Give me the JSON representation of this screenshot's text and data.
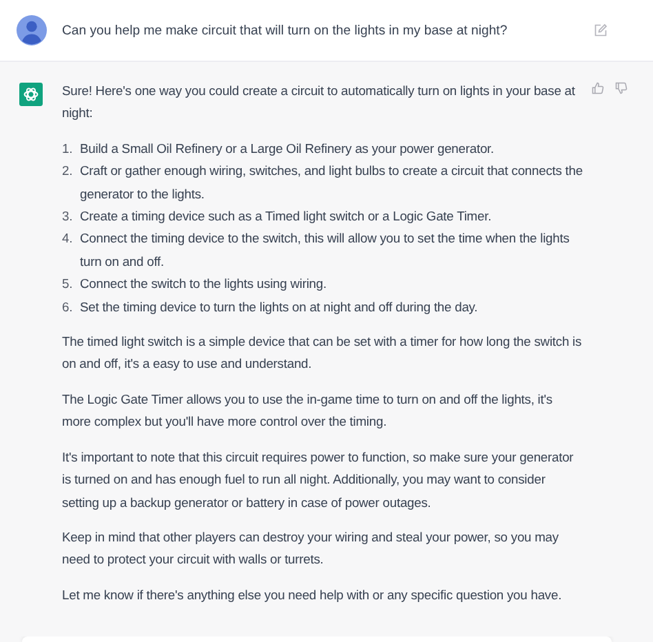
{
  "prompt": {
    "text": "Can you help me make circuit that will turn on the lights in my base at night?"
  },
  "answer": {
    "blocks": [
      {
        "kind": "paragraph",
        "text": "Sure! Here's one way you could create a circuit to automatically turn on lights in your base at night:"
      },
      {
        "kind": "list",
        "items": [
          {
            "number": "1.",
            "text": "Build a Small Oil Refinery or a Large Oil Refinery as your power generator."
          },
          {
            "number": "2.",
            "text": "Craft or gather enough wiring, switches, and light bulbs to create a circuit that connects the generator to the lights."
          },
          {
            "number": "3.",
            "text": "Create a timing device such as a Timed light switch or a Logic Gate Timer."
          },
          {
            "number": "4.",
            "text": "Connect the timing device to the switch, this will allow you to set the time when the lights turn on and off."
          },
          {
            "number": "5.",
            "text": "Connect the switch to the lights using wiring."
          },
          {
            "number": "6.",
            "text": "Set the timing device to turn the lights on at night and off during the day."
          }
        ]
      },
      {
        "kind": "paragraph",
        "text": "The timed light switch is a simple device that can be set with a timer for how long the switch is on and off, it's a easy to use and understand."
      },
      {
        "kind": "paragraph",
        "text": "The Logic Gate Timer allows you to use the in-game time to turn on and off the lights, it's more complex but you'll have more control over the timing."
      },
      {
        "kind": "paragraph",
        "text": "It's important to note that this circuit requires power to function, so make sure your generator is turned on and has enough fuel to run all night. Additionally, you may want to consider setting up a backup generator or battery in case of power outages."
      },
      {
        "kind": "paragraph",
        "text": "Keep in mind that other players can destroy your wiring and steal your power, so you may need to protect your circuit with walls or turrets."
      },
      {
        "kind": "paragraph",
        "text": "Let me know if there's anything else you need help with or any specific question you have."
      }
    ]
  }
}
